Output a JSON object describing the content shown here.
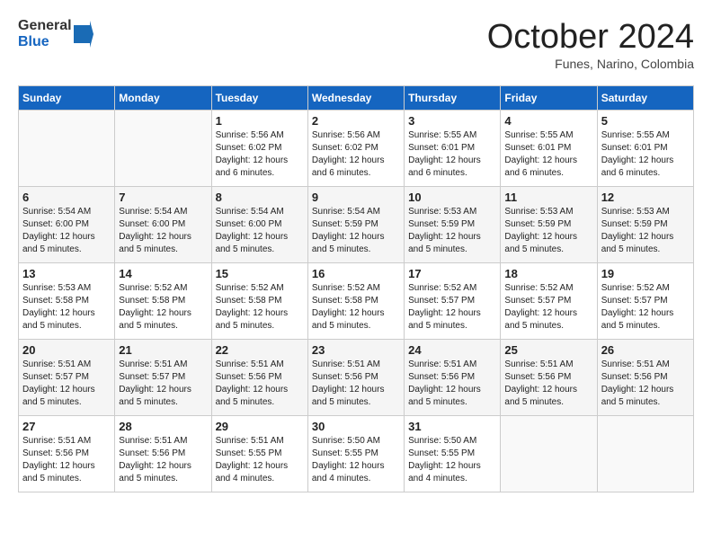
{
  "header": {
    "logo_general": "General",
    "logo_blue": "Blue",
    "month_title": "October 2024",
    "subtitle": "Funes, Narino, Colombia"
  },
  "weekdays": [
    "Sunday",
    "Monday",
    "Tuesday",
    "Wednesday",
    "Thursday",
    "Friday",
    "Saturday"
  ],
  "weeks": [
    [
      {
        "day": "",
        "info": ""
      },
      {
        "day": "",
        "info": ""
      },
      {
        "day": "1",
        "info": "Sunrise: 5:56 AM\nSunset: 6:02 PM\nDaylight: 12 hours\nand 6 minutes."
      },
      {
        "day": "2",
        "info": "Sunrise: 5:56 AM\nSunset: 6:02 PM\nDaylight: 12 hours\nand 6 minutes."
      },
      {
        "day": "3",
        "info": "Sunrise: 5:55 AM\nSunset: 6:01 PM\nDaylight: 12 hours\nand 6 minutes."
      },
      {
        "day": "4",
        "info": "Sunrise: 5:55 AM\nSunset: 6:01 PM\nDaylight: 12 hours\nand 6 minutes."
      },
      {
        "day": "5",
        "info": "Sunrise: 5:55 AM\nSunset: 6:01 PM\nDaylight: 12 hours\nand 6 minutes."
      }
    ],
    [
      {
        "day": "6",
        "info": "Sunrise: 5:54 AM\nSunset: 6:00 PM\nDaylight: 12 hours\nand 5 minutes."
      },
      {
        "day": "7",
        "info": "Sunrise: 5:54 AM\nSunset: 6:00 PM\nDaylight: 12 hours\nand 5 minutes."
      },
      {
        "day": "8",
        "info": "Sunrise: 5:54 AM\nSunset: 6:00 PM\nDaylight: 12 hours\nand 5 minutes."
      },
      {
        "day": "9",
        "info": "Sunrise: 5:54 AM\nSunset: 5:59 PM\nDaylight: 12 hours\nand 5 minutes."
      },
      {
        "day": "10",
        "info": "Sunrise: 5:53 AM\nSunset: 5:59 PM\nDaylight: 12 hours\nand 5 minutes."
      },
      {
        "day": "11",
        "info": "Sunrise: 5:53 AM\nSunset: 5:59 PM\nDaylight: 12 hours\nand 5 minutes."
      },
      {
        "day": "12",
        "info": "Sunrise: 5:53 AM\nSunset: 5:59 PM\nDaylight: 12 hours\nand 5 minutes."
      }
    ],
    [
      {
        "day": "13",
        "info": "Sunrise: 5:53 AM\nSunset: 5:58 PM\nDaylight: 12 hours\nand 5 minutes."
      },
      {
        "day": "14",
        "info": "Sunrise: 5:52 AM\nSunset: 5:58 PM\nDaylight: 12 hours\nand 5 minutes."
      },
      {
        "day": "15",
        "info": "Sunrise: 5:52 AM\nSunset: 5:58 PM\nDaylight: 12 hours\nand 5 minutes."
      },
      {
        "day": "16",
        "info": "Sunrise: 5:52 AM\nSunset: 5:58 PM\nDaylight: 12 hours\nand 5 minutes."
      },
      {
        "day": "17",
        "info": "Sunrise: 5:52 AM\nSunset: 5:57 PM\nDaylight: 12 hours\nand 5 minutes."
      },
      {
        "day": "18",
        "info": "Sunrise: 5:52 AM\nSunset: 5:57 PM\nDaylight: 12 hours\nand 5 minutes."
      },
      {
        "day": "19",
        "info": "Sunrise: 5:52 AM\nSunset: 5:57 PM\nDaylight: 12 hours\nand 5 minutes."
      }
    ],
    [
      {
        "day": "20",
        "info": "Sunrise: 5:51 AM\nSunset: 5:57 PM\nDaylight: 12 hours\nand 5 minutes."
      },
      {
        "day": "21",
        "info": "Sunrise: 5:51 AM\nSunset: 5:57 PM\nDaylight: 12 hours\nand 5 minutes."
      },
      {
        "day": "22",
        "info": "Sunrise: 5:51 AM\nSunset: 5:56 PM\nDaylight: 12 hours\nand 5 minutes."
      },
      {
        "day": "23",
        "info": "Sunrise: 5:51 AM\nSunset: 5:56 PM\nDaylight: 12 hours\nand 5 minutes."
      },
      {
        "day": "24",
        "info": "Sunrise: 5:51 AM\nSunset: 5:56 PM\nDaylight: 12 hours\nand 5 minutes."
      },
      {
        "day": "25",
        "info": "Sunrise: 5:51 AM\nSunset: 5:56 PM\nDaylight: 12 hours\nand 5 minutes."
      },
      {
        "day": "26",
        "info": "Sunrise: 5:51 AM\nSunset: 5:56 PM\nDaylight: 12 hours\nand 5 minutes."
      }
    ],
    [
      {
        "day": "27",
        "info": "Sunrise: 5:51 AM\nSunset: 5:56 PM\nDaylight: 12 hours\nand 5 minutes."
      },
      {
        "day": "28",
        "info": "Sunrise: 5:51 AM\nSunset: 5:56 PM\nDaylight: 12 hours\nand 5 minutes."
      },
      {
        "day": "29",
        "info": "Sunrise: 5:51 AM\nSunset: 5:55 PM\nDaylight: 12 hours\nand 4 minutes."
      },
      {
        "day": "30",
        "info": "Sunrise: 5:50 AM\nSunset: 5:55 PM\nDaylight: 12 hours\nand 4 minutes."
      },
      {
        "day": "31",
        "info": "Sunrise: 5:50 AM\nSunset: 5:55 PM\nDaylight: 12 hours\nand 4 minutes."
      },
      {
        "day": "",
        "info": ""
      },
      {
        "day": "",
        "info": ""
      }
    ]
  ]
}
